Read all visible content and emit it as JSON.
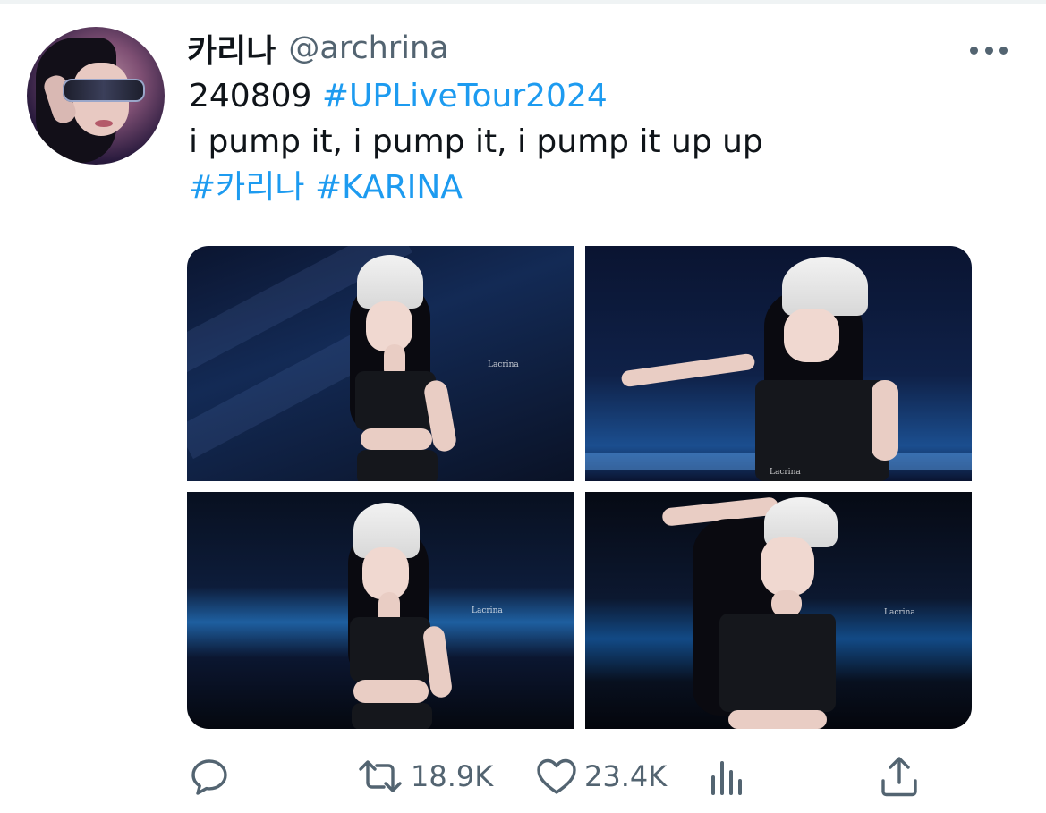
{
  "user": {
    "display_name": "카리나",
    "handle": "@archrina"
  },
  "tweet": {
    "date_prefix": "240809",
    "hashtag_tour": "#UPLiveTour2024",
    "lyric_line": "i pump it, i pump it, i pump it up up",
    "hashtag_karina_kr": "#카리나",
    "hashtag_karina_en": "#KARINA"
  },
  "media": {
    "photos": [
      {
        "watermark": "Lacrina"
      },
      {
        "watermark": "Lacrina"
      },
      {
        "watermark": "Lacrina"
      },
      {
        "watermark": "Lacrina"
      }
    ]
  },
  "actions": {
    "retweet_count": "18.9K",
    "like_count": "23.4K"
  },
  "colors": {
    "link": "#1d9bf0",
    "secondary_text": "#536471",
    "primary_text": "#0f1419"
  },
  "icons": {
    "more": "more-horizontal-icon",
    "reply": "reply-icon",
    "retweet": "retweet-icon",
    "like": "heart-icon",
    "views": "views-bar-chart-icon",
    "share": "share-icon"
  }
}
